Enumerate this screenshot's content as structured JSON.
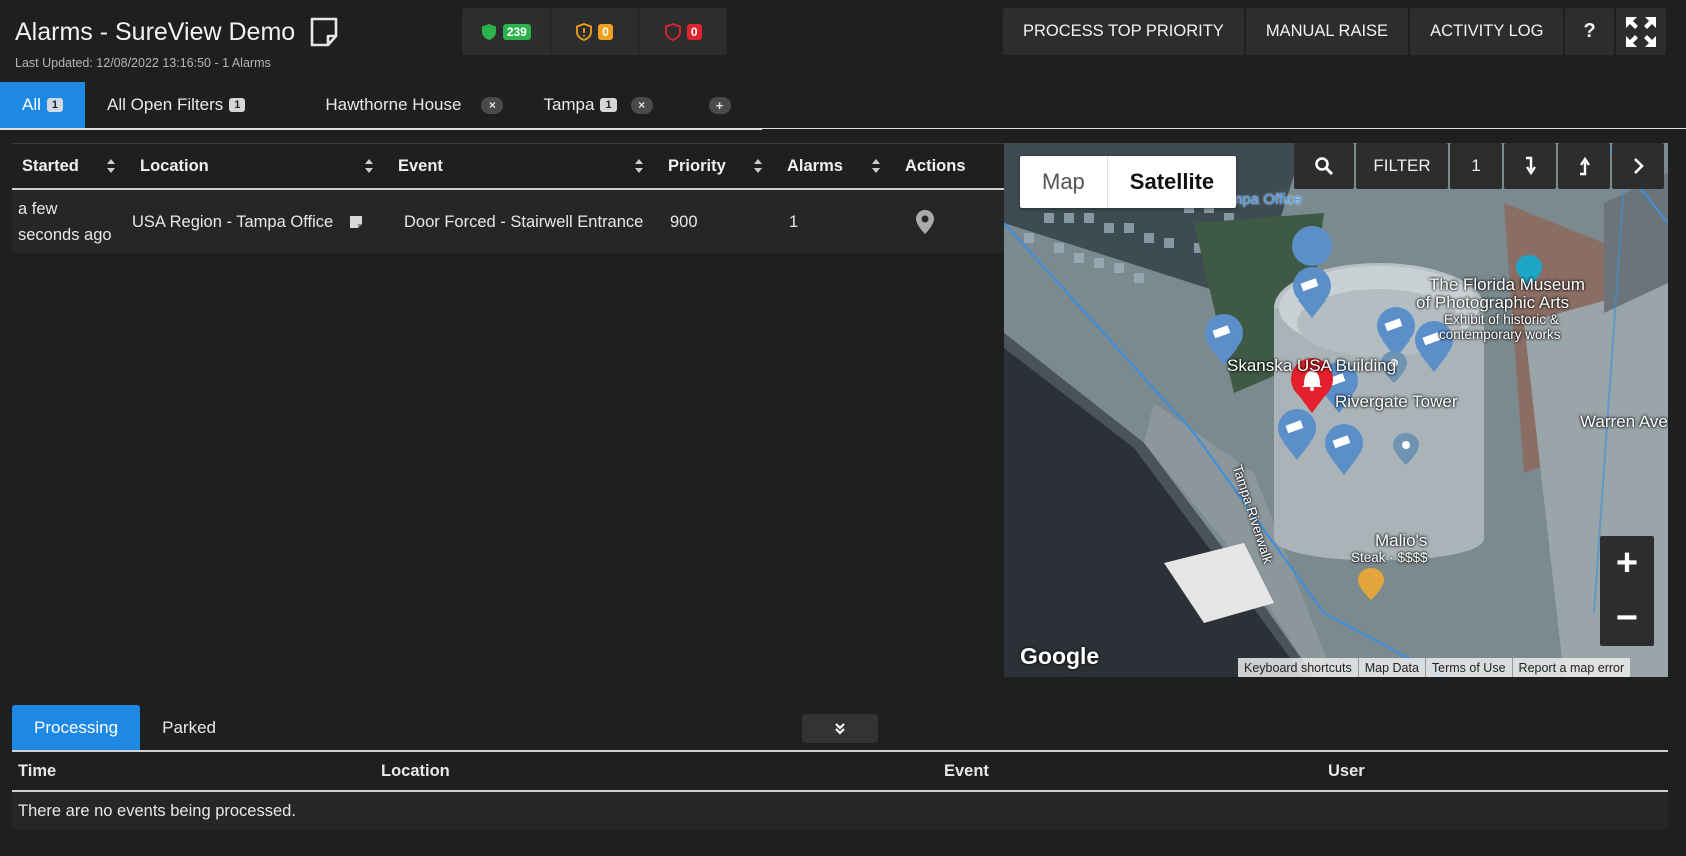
{
  "header": {
    "title": "Alarms - SureView Demo",
    "last_updated": "Last Updated: 12/08/2022 13:16:50 - 1 Alarms"
  },
  "status": {
    "secure_count": "239",
    "warning_count": "0",
    "alert_count": "0",
    "colors": {
      "secure": "#2bb24c",
      "warning": "#f0a020",
      "alert": "#e0242f"
    }
  },
  "toolbar": {
    "process_top_priority": "PROCESS TOP PRIORITY",
    "manual_raise": "MANUAL RAISE",
    "activity_log": "ACTIVITY LOG",
    "help": "?"
  },
  "tabs": [
    {
      "label": "All",
      "count": "1"
    },
    {
      "label": "All Open Filters",
      "count": "1"
    },
    {
      "label": "Hawthorne House",
      "count": ""
    },
    {
      "label": "Tampa",
      "count": "1"
    }
  ],
  "alarm_table": {
    "columns": [
      "Started",
      "Location",
      "Event",
      "Priority",
      "Alarms",
      "Actions"
    ],
    "rows": [
      {
        "started": "a few seconds ago",
        "location": "USA Region - Tampa Office",
        "event": "Door Forced - Stairwell Entrance",
        "priority": "900",
        "alarms": "1"
      }
    ]
  },
  "map": {
    "type_map": "Map",
    "type_satellite": "Satellite",
    "filter_label": "FILTER",
    "filter_count": "1",
    "labels": {
      "tampa_office": "Tampa Office",
      "museum_1": "The Florida Museum",
      "museum_2": "of Photographic Arts",
      "museum_3": "Exhibit of historic &",
      "museum_4": "contemporary works",
      "skanska": "Skanska USA Building",
      "rivergate": "Rivergate Tower",
      "riverwalk": "Tampa Riverwalk",
      "warren": "Warren Ave",
      "malios_1": "Malio's",
      "malios_2": "Steak · $$$$"
    },
    "google": "Google",
    "attribution": [
      "Keyboard shortcuts",
      "Map Data",
      "Terms of Use",
      "Report a map error"
    ]
  },
  "processing": {
    "tabs": [
      "Processing",
      "Parked"
    ],
    "columns": [
      "Time",
      "Location",
      "Event",
      "User"
    ],
    "empty_message": "There are no events being processed."
  }
}
